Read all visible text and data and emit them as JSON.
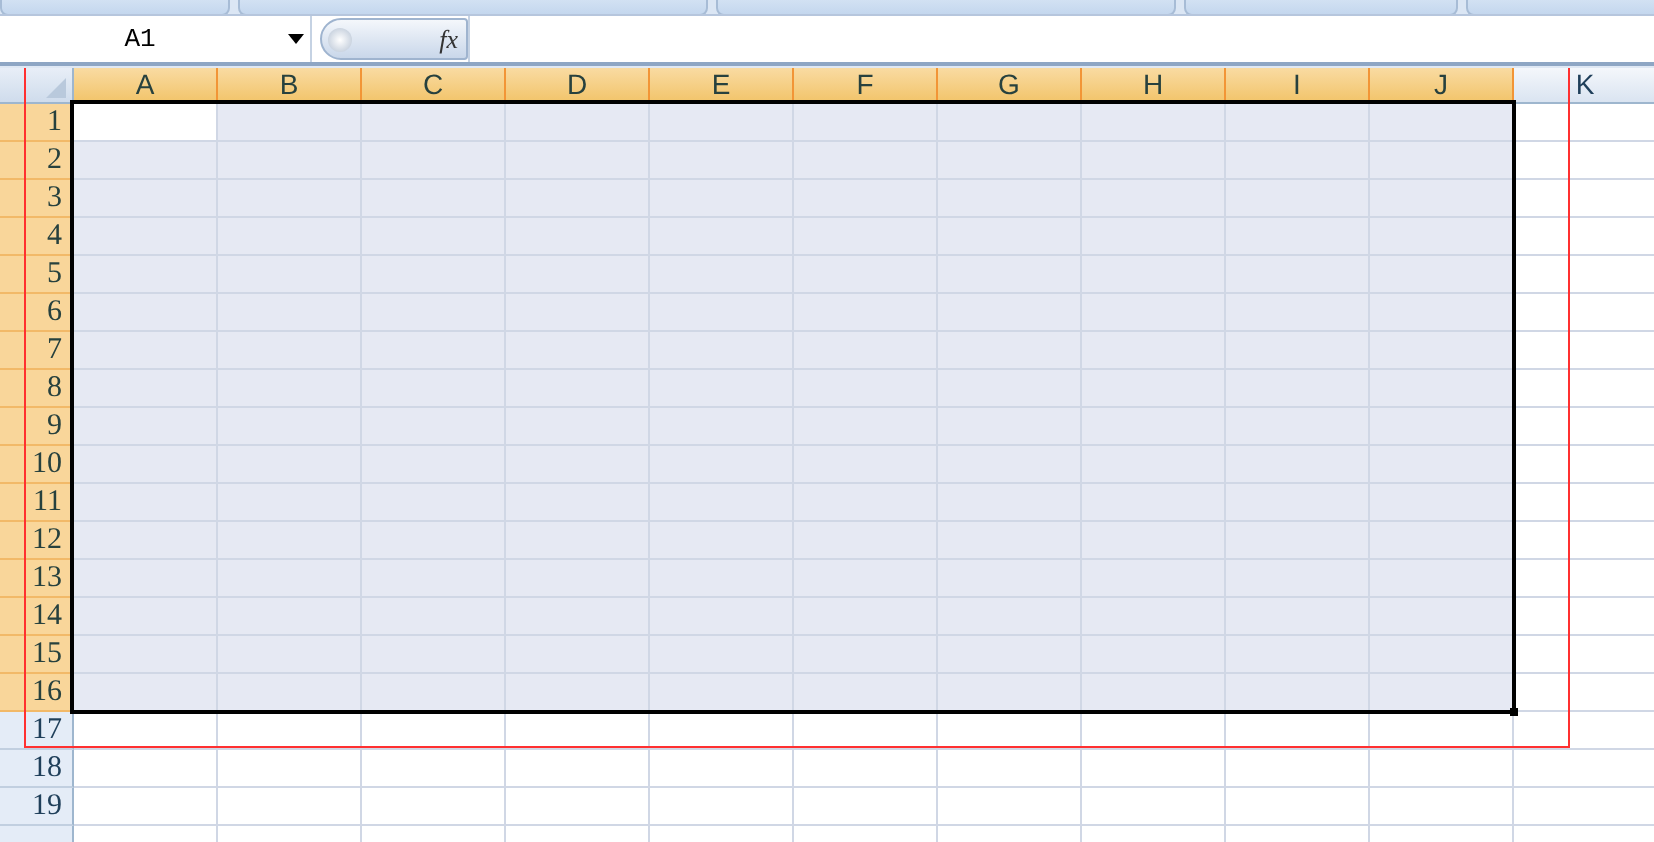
{
  "name_box": {
    "value": "A1"
  },
  "formula_bar": {
    "function_label": "fx"
  },
  "columns": [
    {
      "label": "A",
      "selected": true
    },
    {
      "label": "B",
      "selected": true
    },
    {
      "label": "C",
      "selected": true
    },
    {
      "label": "D",
      "selected": true
    },
    {
      "label": "E",
      "selected": true
    },
    {
      "label": "F",
      "selected": true
    },
    {
      "label": "G",
      "selected": true
    },
    {
      "label": "H",
      "selected": true
    },
    {
      "label": "I",
      "selected": true
    },
    {
      "label": "J",
      "selected": true
    },
    {
      "label": "K",
      "selected": false
    }
  ],
  "rows": [
    {
      "label": "1",
      "selected": true
    },
    {
      "label": "2",
      "selected": true
    },
    {
      "label": "3",
      "selected": true
    },
    {
      "label": "4",
      "selected": true
    },
    {
      "label": "5",
      "selected": true
    },
    {
      "label": "6",
      "selected": true
    },
    {
      "label": "7",
      "selected": true
    },
    {
      "label": "8",
      "selected": true
    },
    {
      "label": "9",
      "selected": true
    },
    {
      "label": "10",
      "selected": true
    },
    {
      "label": "11",
      "selected": true
    },
    {
      "label": "12",
      "selected": true
    },
    {
      "label": "13",
      "selected": true
    },
    {
      "label": "14",
      "selected": true
    },
    {
      "label": "15",
      "selected": true
    },
    {
      "label": "16",
      "selected": true
    },
    {
      "label": "17",
      "selected": false
    },
    {
      "label": "18",
      "selected": false
    },
    {
      "label": "19",
      "selected": false
    },
    {
      "selected": false
    }
  ]
}
